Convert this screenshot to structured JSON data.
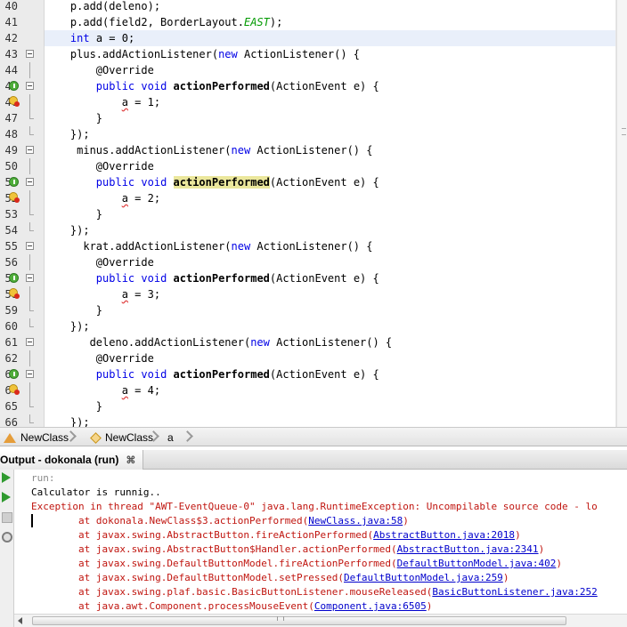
{
  "editor": {
    "lines": [
      {
        "n": "40",
        "t": "    p.add(deleno);"
      },
      {
        "n": "41",
        "t": "    p.add(field2, BorderLayout.EAST);"
      },
      {
        "n": "42",
        "t": "    int a = 0;"
      },
      {
        "n": "43",
        "t": "    plus.addActionListener(new ActionListener() {"
      },
      {
        "n": "44",
        "t": "        @Override"
      },
      {
        "n": "45",
        "t": "        public void actionPerformed(ActionEvent e) {"
      },
      {
        "n": "46",
        "t": "            a = 1;"
      },
      {
        "n": "47",
        "t": "        }"
      },
      {
        "n": "48",
        "t": "    });"
      },
      {
        "n": "49",
        "t": "     minus.addActionListener(new ActionListener() {"
      },
      {
        "n": "50",
        "t": "        @Override"
      },
      {
        "n": "51",
        "t": "        public void actionPerformed(ActionEvent e) {"
      },
      {
        "n": "52",
        "t": "            a = 2;"
      },
      {
        "n": "53",
        "t": "        }"
      },
      {
        "n": "54",
        "t": "    });"
      },
      {
        "n": "55",
        "t": "      krat.addActionListener(new ActionListener() {"
      },
      {
        "n": "56",
        "t": "        @Override"
      },
      {
        "n": "57",
        "t": "        public void actionPerformed(ActionEvent e) {"
      },
      {
        "n": "58",
        "t": "            a = 3;"
      },
      {
        "n": "59",
        "t": "        }"
      },
      {
        "n": "60",
        "t": "    });"
      },
      {
        "n": "61",
        "t": "       deleno.addActionListener(new ActionListener() {"
      },
      {
        "n": "62",
        "t": "        @Override"
      },
      {
        "n": "63",
        "t": "        public void actionPerformed(ActionEvent e) {"
      },
      {
        "n": "64",
        "t": "            a = 4;"
      },
      {
        "n": "65",
        "t": "        }"
      },
      {
        "n": "66",
        "t": "    });"
      }
    ],
    "highlight_line": "42",
    "colors": {
      "keyword": "#0000e6",
      "static_field": "#009900",
      "current_line": "#e9effa",
      "occurrence": "#ebe79c"
    }
  },
  "breadcrumb": {
    "items": [
      {
        "label": "NewClass",
        "icon": "class-icon"
      },
      {
        "label": "NewClass",
        "icon": "class-field-icon"
      },
      {
        "label": "a",
        "icon": "none"
      }
    ]
  },
  "output": {
    "tab_label": "Output - dokonala (run)",
    "close_glyph": "⌘",
    "lines": [
      {
        "text": "run:",
        "style": "gray"
      },
      {
        "text": "Calculator is runnig..",
        "style": "black"
      },
      {
        "text": "Exception in thread \"AWT-EventQueue-0\" java.lang.RuntimeException: Uncompilable source code - lo",
        "style": "red"
      },
      {
        "text": "        at dokonala.NewClass$3.actionPerformed(",
        "link": "NewClass.java:58",
        "tail": ")",
        "style": "red"
      },
      {
        "text": "        at javax.swing.AbstractButton.fireActionPerformed(",
        "link": "AbstractButton.java:2018",
        "tail": ")",
        "style": "red"
      },
      {
        "text": "        at javax.swing.AbstractButton$Handler.actionPerformed(",
        "link": "AbstractButton.java:2341",
        "tail": ")",
        "style": "red"
      },
      {
        "text": "        at javax.swing.DefaultButtonModel.fireActionPerformed(",
        "link": "DefaultButtonModel.java:402",
        "tail": ")",
        "style": "red"
      },
      {
        "text": "        at javax.swing.DefaultButtonModel.setPressed(",
        "link": "DefaultButtonModel.java:259",
        "tail": ")",
        "style": "red"
      },
      {
        "text": "        at javax.swing.plaf.basic.BasicButtonListener.mouseReleased(",
        "link": "BasicButtonListener.java:252",
        "tail": "",
        "style": "red"
      },
      {
        "text": "        at java.awt.Component.processMouseEvent(",
        "link": "Component.java:6505",
        "tail": ")",
        "style": "red"
      }
    ]
  },
  "toolbar": {
    "buttons": [
      "run-icon",
      "rerun-icon",
      "stop-icon",
      "settings-icon"
    ]
  }
}
